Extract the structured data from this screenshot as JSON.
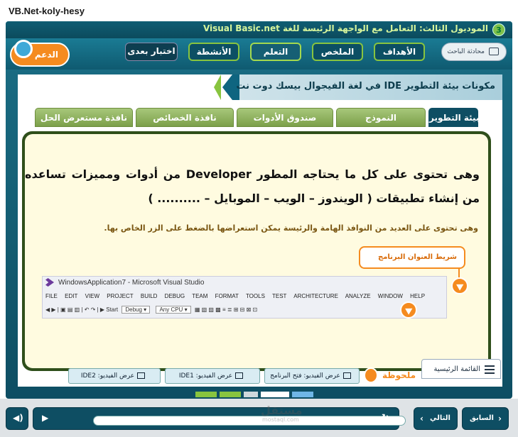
{
  "window": {
    "title": "VB.Net-koly-hesy"
  },
  "top": {
    "module_num": "3",
    "module_title": "الموديول الثالث: التعامل مع الواجهة الرئيسة للغة Visual Basic.net"
  },
  "support": {
    "label": "الدعم"
  },
  "nav": {
    "chat_label": "محادثة الباحث",
    "tabs": [
      "الأهداف",
      "الملخص",
      "التعلم",
      "الأنشطة",
      "اختبار بعدى"
    ]
  },
  "lesson": {
    "heading": "مكونات بيئة التطوير IDE في لغة الفيجوال بيسك دوت نت"
  },
  "content_tabs": [
    "بيئة التطوير",
    "النموذج",
    "صندوق الأدوات",
    "نافذة الخصائص",
    "نافذة مستعرض الحل"
  ],
  "body": {
    "para1": "وهى تحتوى على كل ما يحتاجه المطور Developer من أدوات ومميزات تساعده من إنشاء تطبيقات ( الويندوز – الويب – الموبايل – .......... )",
    "para2": "وهى تحتوى على العديد من النوافذ الهامة والرئيسة يمكن استعراضها بالضغط على الزر الخاص بها.",
    "callout": "شريط العنوان البرنامج"
  },
  "vs": {
    "title": "WindowsApplication7 - Microsoft Visual Studio",
    "menu": [
      "FILE",
      "EDIT",
      "VIEW",
      "PROJECT",
      "BUILD",
      "DEBUG",
      "TEAM",
      "FORMAT",
      "TOOLS",
      "TEST",
      "ARCHITECTURE",
      "ANALYZE",
      "WINDOW",
      "HELP"
    ],
    "start": "Start",
    "config": "Debug",
    "cpu": "Any CPU"
  },
  "notes": {
    "label": "ملحوظة",
    "buttons": [
      "عرض الفيديو: IDE2",
      "عرض الفيديو: IDE1",
      "عرض الفيديو: فتح البرنامج"
    ]
  },
  "main_menu": {
    "label": "القائمة الرئيسية"
  },
  "controls": {
    "next": "التالي",
    "prev": "السابق"
  },
  "watermark": {
    "main": "مستقل",
    "sub": "mostaql.com"
  },
  "colors": {
    "accent": "#f58b1f",
    "green": "#88c43f",
    "teal": "#0e4e63"
  }
}
